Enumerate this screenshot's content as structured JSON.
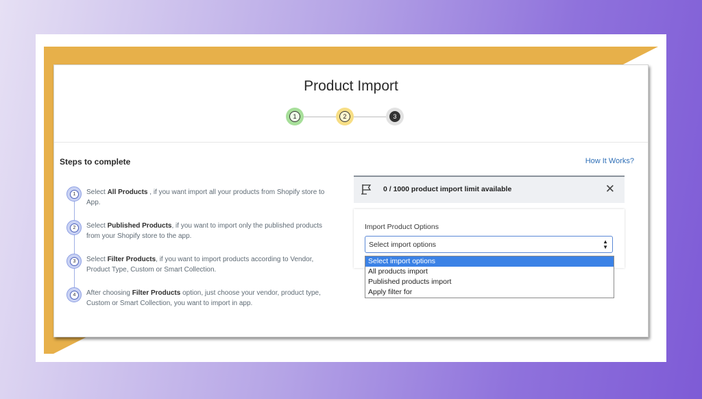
{
  "page": {
    "title": "Product Import"
  },
  "stepper": {
    "steps": [
      "1",
      "2",
      "3"
    ],
    "colors": {
      "step1": "#a7df9a",
      "step2": "#f7de85",
      "step3": "#e2e2e2"
    }
  },
  "steps_section": {
    "title": "Steps to complete",
    "how_link": "How It Works?",
    "items": [
      {
        "num": "1",
        "pre": "Select ",
        "bold": "All Products",
        "post": " , if you want import all your products from Shopify store to App."
      },
      {
        "num": "2",
        "pre": "Select ",
        "bold": "Published Products",
        "post": ", if you want to import only the published products from your Shopify store to the app."
      },
      {
        "num": "3",
        "pre": "Select ",
        "bold": "Filter Products",
        "post": ", if you want to import products according to Vendor, Product Type, Custom or Smart Collection."
      },
      {
        "num": "4",
        "pre": "After choosing ",
        "bold": "Filter Products",
        "post": " option, just choose your vendor, product type, Custom or Smart Collection, you want to import in app."
      }
    ]
  },
  "banner": {
    "text": "0 / 1000 product import limit available",
    "icon": "flag-icon",
    "close_icon": "close-icon"
  },
  "import_options": {
    "label": "Import Product Options",
    "selected": "Select import options",
    "options": [
      "Select import options",
      "All products import",
      "Published products import",
      "Apply filter for"
    ]
  },
  "colors": {
    "accent_gold": "#e7b04a",
    "link_blue": "#2f6fb7",
    "highlight_blue": "#3b82e6",
    "background_purple": "#8f72dc"
  }
}
